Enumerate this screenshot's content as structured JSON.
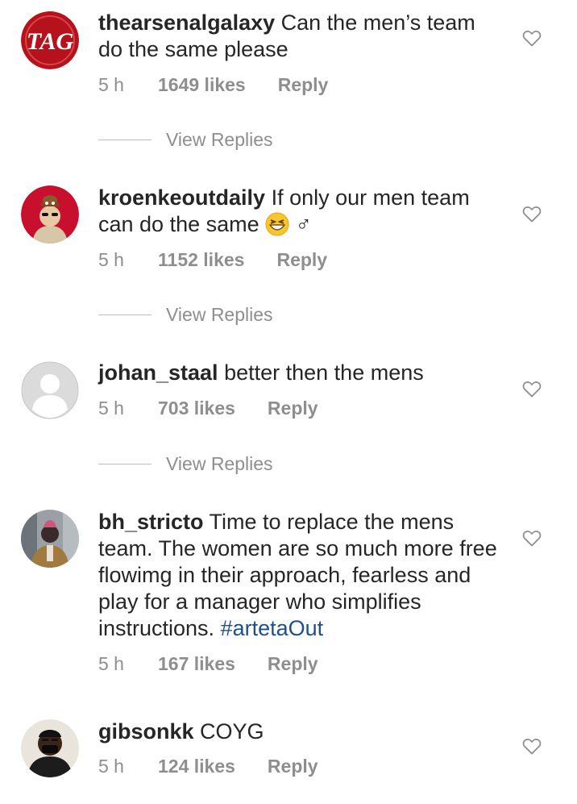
{
  "comments": [
    {
      "username": "thearsenalgalaxy",
      "text": "Can the men’s team do the same please",
      "time": "5 h",
      "likes": "1649 likes",
      "reply": "Reply",
      "view_replies": "View Replies",
      "avatar_text": "TAG",
      "avatar_color": "#b5121b"
    },
    {
      "username": "kroenkeoutdaily",
      "text": "If only our men team can do the same",
      "suffix": "♂",
      "time": "5 h",
      "likes": "1152 likes",
      "reply": "Reply",
      "view_replies": "View Replies",
      "avatar_color": "#c8102e"
    },
    {
      "username": "johan_staal",
      "text": "better then the mens",
      "time": "5 h",
      "likes": "703 likes",
      "reply": "Reply",
      "view_replies": "View Replies",
      "avatar_color": "#dbdbdb"
    },
    {
      "username": "bh_stricto",
      "text": "Time to replace the mens team. The women are so much more free flowimg in their approach, fearless and play for a manager who simplifies instructions.",
      "hashtag": "#artetaOut",
      "time": "5 h",
      "likes": "167 likes",
      "reply": "Reply",
      "avatar_color": "#7a6a55"
    },
    {
      "username": "gibsonkk",
      "text": "COYG",
      "time": "5 h",
      "likes": "124 likes",
      "reply": "Reply",
      "avatar_color": "#4a4a4a"
    }
  ],
  "icons": {
    "like": "heart-outline-icon",
    "default_avatar": "person-silhouette-icon"
  }
}
